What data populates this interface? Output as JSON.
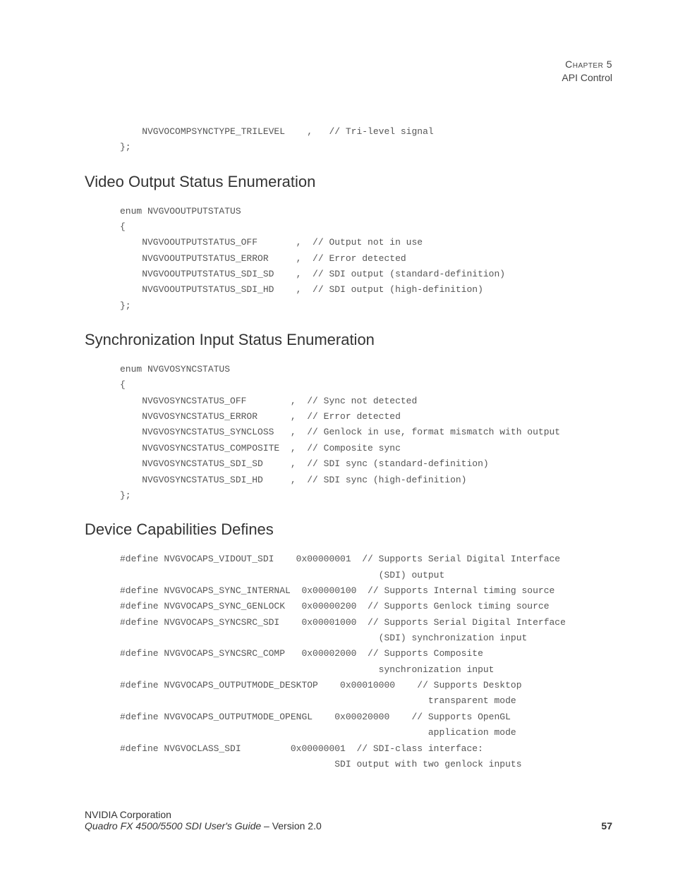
{
  "header": {
    "chapter_line": "Chapter 5",
    "subtitle": "API Control"
  },
  "code0": "    NVGVOCOMPSYNCTYPE_TRILEVEL    ,   // Tri-level signal\n};",
  "section1": {
    "title": "Video Output Status Enumeration",
    "code": "enum NVGVOOUTPUTSTATUS\n{\n    NVGVOOUTPUTSTATUS_OFF       ,  // Output not in use\n    NVGVOOUTPUTSTATUS_ERROR     ,  // Error detected\n    NVGVOOUTPUTSTATUS_SDI_SD    ,  // SDI output (standard-definition)\n    NVGVOOUTPUTSTATUS_SDI_HD    ,  // SDI output (high-definition)\n};"
  },
  "section2": {
    "title": "Synchronization Input Status Enumeration",
    "code": "enum NVGVOSYNCSTATUS\n{\n    NVGVOSYNCSTATUS_OFF        ,  // Sync not detected\n    NVGVOSYNCSTATUS_ERROR      ,  // Error detected\n    NVGVOSYNCSTATUS_SYNCLOSS   ,  // Genlock in use, format mismatch with output\n    NVGVOSYNCSTATUS_COMPOSITE  ,  // Composite sync\n    NVGVOSYNCSTATUS_SDI_SD     ,  // SDI sync (standard-definition)\n    NVGVOSYNCSTATUS_SDI_HD     ,  // SDI sync (high-definition)\n};"
  },
  "section3": {
    "title": "Device Capabilities Defines",
    "code": "#define NVGVOCAPS_VIDOUT_SDI    0x00000001  // Supports Serial Digital Interface\n                                               (SDI) output\n#define NVGVOCAPS_SYNC_INTERNAL  0x00000100  // Supports Internal timing source\n#define NVGVOCAPS_SYNC_GENLOCK   0x00000200  // Supports Genlock timing source\n#define NVGVOCAPS_SYNCSRC_SDI    0x00001000  // Supports Serial Digital Interface\n                                               (SDI) synchronization input\n#define NVGVOCAPS_SYNCSRC_COMP   0x00002000  // Supports Composite\n                                               synchronization input\n#define NVGVOCAPS_OUTPUTMODE_DESKTOP    0x00010000    // Supports Desktop\n                                                        transparent mode\n#define NVGVOCAPS_OUTPUTMODE_OPENGL    0x00020000    // Supports OpenGL\n                                                        application mode\n#define NVGVOCLASS_SDI         0x00000001  // SDI-class interface:\n                                       SDI output with two genlock inputs"
  },
  "footer": {
    "corp": "NVIDIA Corporation",
    "title": "Quadro FX 4500/5500 SDI User's Guide",
    "version_sep": " – Version 2.0",
    "page": "57"
  }
}
